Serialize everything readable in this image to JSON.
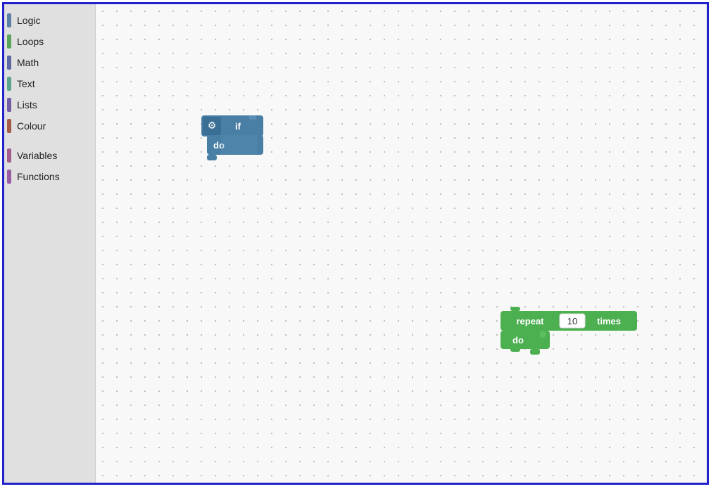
{
  "sidebar": {
    "items": [
      {
        "label": "Logic",
        "color": "#5b80a5"
      },
      {
        "label": "Loops",
        "color": "#5ba55b"
      },
      {
        "label": "Math",
        "color": "#5b67a5"
      },
      {
        "label": "Text",
        "color": "#5ba58c"
      },
      {
        "label": "Lists",
        "color": "#745ba5"
      },
      {
        "label": "Colour",
        "color": "#a55b45"
      },
      {
        "label": "Variables",
        "color": "#a55b8c"
      },
      {
        "label": "Functions",
        "color": "#9a5ba5"
      }
    ]
  },
  "blocks": {
    "if_block": {
      "label_if": "if",
      "label_do": "do"
    },
    "repeat_block": {
      "label_repeat": "repeat",
      "value": "10",
      "label_times": "times",
      "label_do": "do"
    }
  }
}
